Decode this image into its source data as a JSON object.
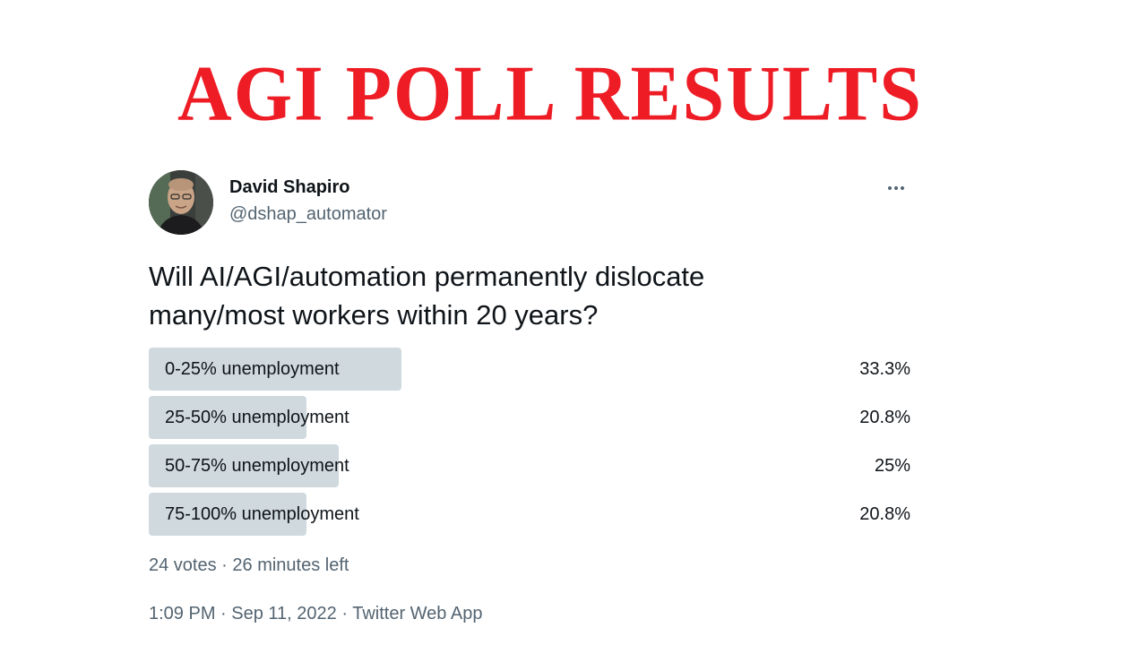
{
  "banner": {
    "title": "AGI POLL RESULTS",
    "color": "#ee1c25"
  },
  "tweet": {
    "author": {
      "name": "David Shapiro",
      "handle": "@dshap_automator"
    },
    "more_icon": "more-horizontal-icon",
    "question_line1": "Will AI/AGI/automation permanently dislocate",
    "question_line2": "many/most workers within 20 years?",
    "poll": {
      "options": [
        {
          "label": "0-25% unemployment",
          "percent_text": "33.3%",
          "percent": 33.3
        },
        {
          "label": "25-50% unemployment",
          "percent_text": "20.8%",
          "percent": 20.8
        },
        {
          "label": "50-75% unemployment",
          "percent_text": "25%",
          "percent": 25
        },
        {
          "label": "75-100% unemployment",
          "percent_text": "20.8%",
          "percent": 20.8
        }
      ],
      "bar_color": "#cfd9de",
      "votes": "24 votes",
      "separator": " · ",
      "time_left": "26 minutes left"
    },
    "meta": {
      "time": "1:09 PM",
      "date": "Sep 11, 2022",
      "source": "Twitter Web App",
      "separator": " · "
    }
  }
}
